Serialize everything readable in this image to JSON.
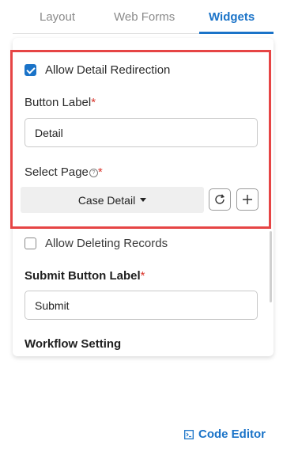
{
  "tabs": [
    {
      "label": "Layout"
    },
    {
      "label": "Web Forms"
    },
    {
      "label": "Widgets"
    }
  ],
  "active_tab": "Widgets",
  "detail_redirection": {
    "checkbox_label": "Allow Detail Redirection",
    "checked": true,
    "button_label_title": "Button Label",
    "button_label_value": "Detail",
    "select_page_title": "Select Page",
    "selected_page": "Case Detail"
  },
  "delete_records": {
    "checkbox_label": "Allow Deleting Records",
    "checked": false
  },
  "submit": {
    "title": "Submit Button Label",
    "value": "Submit"
  },
  "workflow_title": "Workflow Setting",
  "required_marker": "*",
  "code_editor_label": "Code Editor",
  "colors": {
    "accent": "#1a73c8",
    "highlight_border": "#e64545",
    "required": "#d9342b"
  }
}
